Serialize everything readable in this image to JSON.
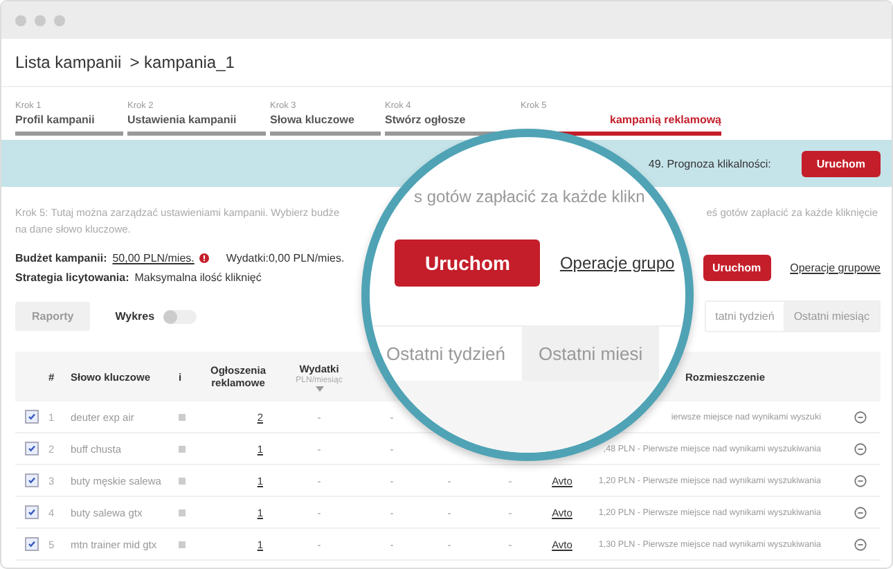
{
  "breadcrumb": {
    "root": "Lista kampanii",
    "current": "> kampania_1"
  },
  "steps": [
    {
      "step": "Krok 1",
      "title": "Profil kampanii",
      "selected": false
    },
    {
      "step": "Krok 2",
      "title": "Ustawienia kampanii",
      "selected": false
    },
    {
      "step": "Krok 3",
      "title": "Słowa kluczowe",
      "selected": false
    },
    {
      "step": "Krok 4",
      "title": "Stwórz ogłosze",
      "selected": false
    },
    {
      "step": "Krok 5",
      "title": "kampanią reklamową",
      "selected": true
    }
  ],
  "banner": {
    "text": "49. Prognoza klikalności:",
    "button": "Uruchom"
  },
  "description": {
    "line_1_left": "Krok 5: Tutaj można zarządzać ustawieniami kampanii. Wybierz budże",
    "line_1_right": "eś gotów zapłacić za każde kliknięcie",
    "line_2": "na dane słowo kluczowe."
  },
  "budget": {
    "label": "Budżet kampanii:",
    "value": "50,00 PLN/mies.",
    "spend": "Wydatki:0,00 PLN/mies."
  },
  "strategy": {
    "label": "Strategia licytowania:",
    "value": "Maksymalna ilość kliknięć"
  },
  "reports_button": {
    "label": "Raporty",
    "disabled": true
  },
  "chart_toggle": {
    "label": "Wykres",
    "on": false
  },
  "actions": {
    "run": "Uruchom",
    "bulk": "Operacje grupowe"
  },
  "period_tabs": [
    {
      "label": "tatni tydzień",
      "selected": true
    },
    {
      "label": "Ostatni miesiąc",
      "selected": false
    }
  ],
  "table": {
    "columns": {
      "number": "#",
      "keyword": "Słowo kluczowe",
      "info": "i",
      "ads": "Ogłoszenia reklamowe",
      "spend": "Wydatki",
      "spend_unit": "PLN/miesiąc",
      "placement": "Rozmieszczenie"
    },
    "rows": [
      {
        "checked": true,
        "number": "1",
        "keyword": "deuter exp air",
        "ads": "2",
        "spend": "-",
        "column_6": "-",
        "placement": "ierwsze miejsce nad wynikami wyszuki"
      },
      {
        "checked": true,
        "number": "2",
        "keyword": "buff chusta",
        "ads": "1",
        "spend": "-",
        "column_6": "-",
        "placement": ",48 PLN - Pierwsze miejsce nad wynikami wyszukiwania"
      },
      {
        "checked": true,
        "number": "3",
        "keyword": "buty męskie salewa",
        "ads": "1",
        "spend": "-",
        "column_6": "-",
        "column_7": "-",
        "column_8": "-",
        "bid": "Avto",
        "placement": "1,20 PLN - Pierwsze miejsce nad wynikami wyszukiwania"
      },
      {
        "checked": true,
        "number": "4",
        "keyword": "buty salewa gtx",
        "ads": "1",
        "spend": "-",
        "column_6": "-",
        "column_7": "-",
        "column_8": "-",
        "bid": "Avto",
        "placement": "1,20 PLN - Pierwsze miejsce nad wynikami wyszukiwania"
      },
      {
        "checked": true,
        "number": "5",
        "keyword": "mtn trainer mid gtx",
        "ads": "1",
        "spend": "-",
        "column_6": "-",
        "column_7": "-",
        "column_8": "-",
        "bid": "Avto",
        "placement": "1,30 PLN - Pierwsze miejsce nad wynikami wyszukiwania"
      }
    ]
  },
  "magnifier": {
    "heading": "s gotów zapłacić za każde klikn",
    "button": "Uruchom",
    "link": "Operacje grupo",
    "tabs": [
      {
        "label": "Ostatni tydzień",
        "selected": true
      },
      {
        "label": "Ostatni miesi",
        "selected": false
      }
    ]
  }
}
